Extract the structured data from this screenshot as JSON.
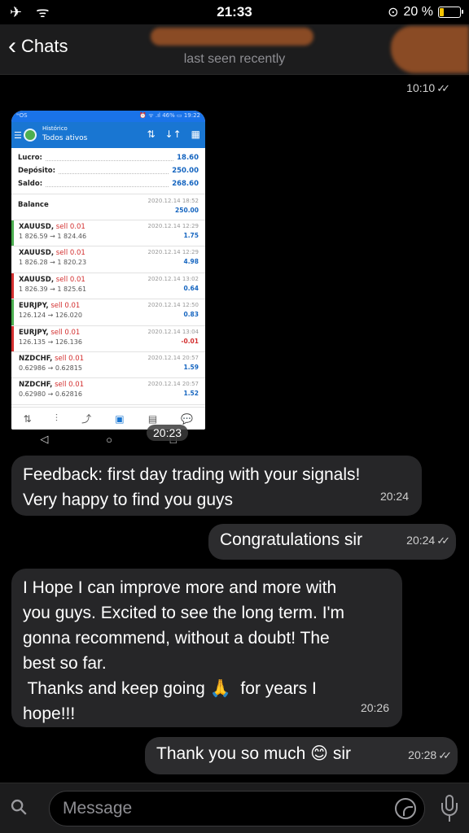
{
  "status_bar": {
    "time": "21:33",
    "left_icons": "✈ ᯤ",
    "battery_percent": "20 %",
    "battery_level": 0.2,
    "battery_color": "#f5c400"
  },
  "header": {
    "back_label": "Chats",
    "status": "last seen recently"
  },
  "image_message": {
    "time": "10:10",
    "photo_time": "20:23",
    "screenshot": {
      "status_left": "ʷOS",
      "status_right": "⏰ ᯤ .ıl 46% ▭ 19:22",
      "section": "Histórico",
      "filter": "Todos ativos",
      "summary": [
        {
          "label": "Lucro:",
          "value": "18.60"
        },
        {
          "label": "Depósito:",
          "value": "250.00"
        },
        {
          "label": "Saldo:",
          "value": "268.60"
        }
      ],
      "balance": {
        "name": "Balance",
        "date": "2020.12.14 18:52",
        "amount": "250.00"
      },
      "trades": [
        {
          "symbol": "XAUUSD,",
          "side": "sell 0.01",
          "prices": "1 826.59 → 1 824.46",
          "date": "2020.12.14 12:29",
          "profit": "1.75",
          "bar": "#4caf50"
        },
        {
          "symbol": "XAUUSD,",
          "side": "sell 0.01",
          "prices": "1 826.28 → 1 820.23",
          "date": "2020.12.14 12:29",
          "profit": "4.98",
          "bar": "#ffffff"
        },
        {
          "symbol": "XAUUSD,",
          "side": "sell 0.01",
          "prices": "1 826.39 → 1 825.61",
          "date": "2020.12.14 13:02",
          "profit": "0.64",
          "bar": "#d32f2f"
        },
        {
          "symbol": "EURJPY,",
          "side": "sell 0.01",
          "prices": "126.124 → 126.020",
          "date": "2020.12.14 12:50",
          "profit": "0.83",
          "bar": "#4caf50"
        },
        {
          "symbol": "EURJPY,",
          "side": "sell 0.01",
          "prices": "126.135 → 126.136",
          "date": "2020.12.14 13:04",
          "profit": "-0.01",
          "bar": "#d32f2f"
        },
        {
          "symbol": "NZDCHF,",
          "side": "sell 0.01",
          "prices": "0.62986 → 0.62815",
          "date": "2020.12.14 20:57",
          "profit": "1.59",
          "bar": "#ffffff"
        },
        {
          "symbol": "NZDCHF,",
          "side": "sell 0.01",
          "prices": "0.62980 → 0.62816",
          "date": "2020.12.14 20:57",
          "profit": "1.52",
          "bar": "#ffffff"
        }
      ],
      "bottom_icons": [
        "⇅",
        "⫶",
        "⤴",
        "▣",
        "▤",
        "💬"
      ],
      "nav_icons": [
        "◁",
        "○",
        "□"
      ]
    }
  },
  "messages": [
    {
      "direction": "in",
      "lines": [
        "Feedback: first day trading with your signals!",
        "Very happy to find you guys"
      ],
      "time": "20:24"
    },
    {
      "direction": "out",
      "lines": [
        "Congratulations sir"
      ],
      "time": "20:24"
    },
    {
      "direction": "in",
      "lines": [
        "I Hope I can improve more and more with",
        "you guys. Excited to see the long term. I'm",
        "gonna recommend, without a doubt! The",
        "best so far.",
        " Thanks and keep going 🙏  for years I",
        "hope!!!"
      ],
      "time": "20:26"
    },
    {
      "direction": "out",
      "lines": [
        "Thank you so much 😊 sir"
      ],
      "time": "20:28"
    }
  ],
  "input": {
    "placeholder": "Message"
  },
  "colors": {
    "background": "#000000",
    "bubble_in": "#262628",
    "bubble_out": "#2c2c2e",
    "app_accent": "#1976d2"
  }
}
